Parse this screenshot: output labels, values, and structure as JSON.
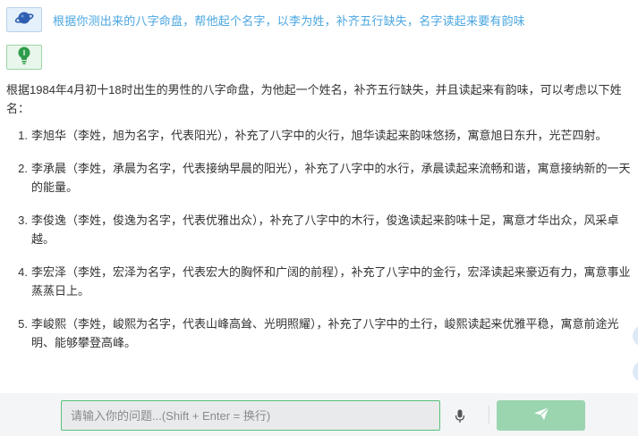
{
  "user_message": {
    "text": "根据你测出来的八字命盘，帮他起个名字，以李为姓，补齐五行缺失，名字读起来要有韵味",
    "avatar_icon": "planet-icon"
  },
  "bot_message": {
    "avatar_icon": "lightbulb-icon",
    "intro": "根据1984年4月初十18时出生的男性的八字命盘，为他起一个姓名，补齐五行缺失，并且读起来有韵味，可以考虑以下姓名：",
    "items": [
      {
        "num": "1.",
        "text": "李旭华（李姓，旭为名字，代表阳光），补充了八字中的火行，旭华读起来韵味悠扬，寓意旭日东升，光芒四射。"
      },
      {
        "num": "2.",
        "text": "李承晨（李姓，承晨为名字，代表接纳早晨的阳光），补充了八字中的水行，承晨读起来流畅和谐，寓意接纳新的一天的能量。"
      },
      {
        "num": "3.",
        "text": "李俊逸（李姓，俊逸为名字，代表优雅出众），补充了八字中的木行，俊逸读起来韵味十足，寓意才华出众，风采卓越。"
      },
      {
        "num": "4.",
        "text": "李宏泽（李姓，宏泽为名字，代表宏大的胸怀和广阔的前程），补充了八字中的金行，宏泽读起来豪迈有力，寓意事业蒸蒸日上。"
      },
      {
        "num": "5.",
        "text": "李峻熙（李姓，峻熙为名字，代表山峰高耸、光明照耀），补充了八字中的土行，峻熙读起来优雅平稳，寓意前途光明、能够攀登高峰。"
      }
    ]
  },
  "input": {
    "placeholder": "请输入你的问题...(Shift + Enter = 换行)",
    "value": ""
  },
  "icons": {
    "mic": "microphone-icon",
    "send": "send-icon"
  },
  "colors": {
    "user_text": "#4aa6e0",
    "accent_green": "#57c17a",
    "send_button": "#9ad5b0"
  }
}
